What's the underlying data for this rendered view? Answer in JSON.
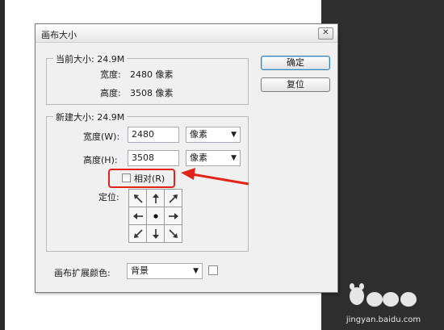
{
  "dialog": {
    "title": "画布大小",
    "close_glyph": "✕"
  },
  "current_size": {
    "legend": "当前大小: 24.9M",
    "width_label": "宽度:",
    "width_value": "2480 像素",
    "height_label": "高度:",
    "height_value": "3508 像素"
  },
  "buttons": {
    "ok": "确定",
    "reset": "复位"
  },
  "new_size": {
    "legend": "新建大小: 24.9M",
    "width_label": "宽度(W):",
    "width_value": "2480",
    "width_unit": "像素",
    "height_label": "高度(H):",
    "height_value": "3508",
    "height_unit": "像素",
    "relative_label": "相对(R)",
    "relative_checked": false,
    "anchor_label": "定位:"
  },
  "extension": {
    "label": "画布扩展颜色:",
    "value": "背景",
    "swatch_color": "#ffffff"
  },
  "annotation": {
    "color": "#e2231a"
  },
  "watermark": {
    "text": "jingyan.baidu.com"
  }
}
